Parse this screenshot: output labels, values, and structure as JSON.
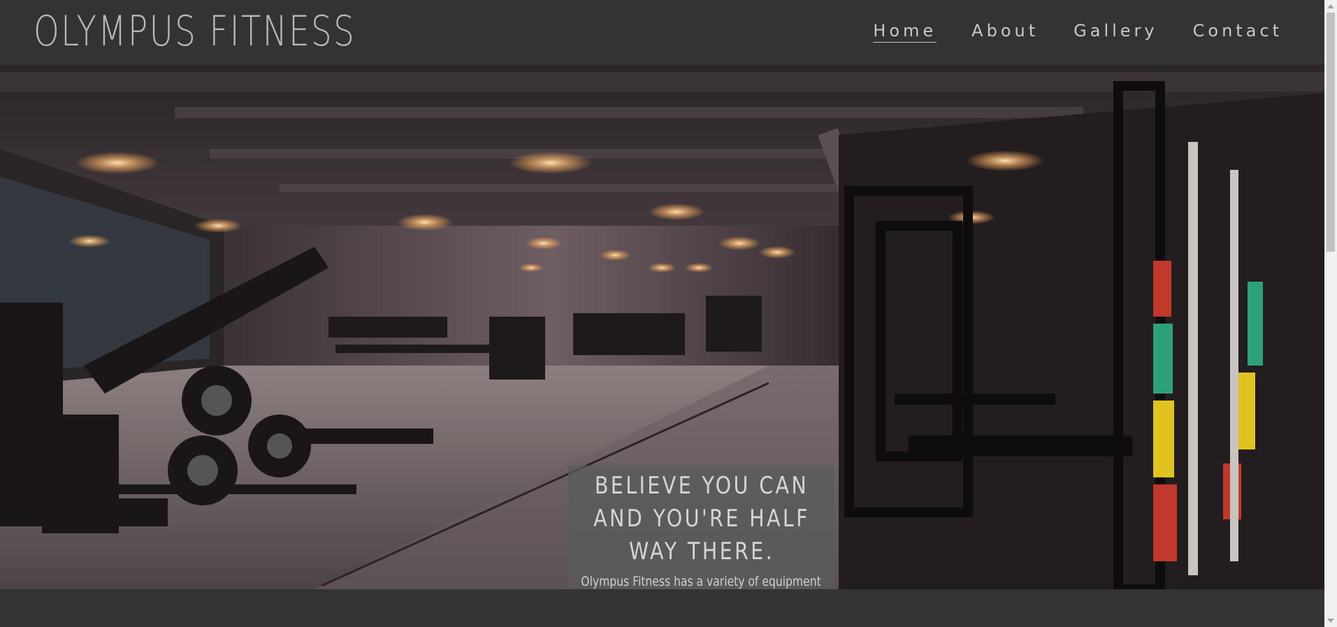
{
  "header": {
    "logo": "OLYMPUS FITNESS"
  },
  "nav": {
    "items": [
      "Home",
      "About",
      "Gallery",
      "Contact"
    ],
    "active": "Home"
  },
  "hero": {
    "image": "gym-interior-photo",
    "headline": "BELIEVE YOU CAN AND YOU'RE HALF WAY THERE.",
    "subtext": "Olympus Fitness has a variety of equipment and classes to help you to reach your personal goal. We offer a range of membership options to suit every need."
  },
  "colors": {
    "background": "#333333",
    "text": "#c8c8c8",
    "overlay": "rgba(90,90,90,0.72)"
  }
}
